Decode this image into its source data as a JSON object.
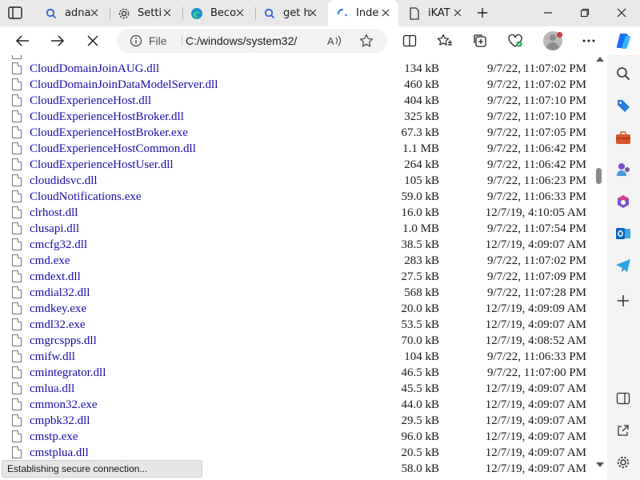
{
  "tabs": [
    {
      "title": "adna",
      "icon": "search-icon"
    },
    {
      "title": "Setti",
      "icon": "gear-icon"
    },
    {
      "title": "Beco",
      "icon": "edge-icon"
    },
    {
      "title": "get h",
      "icon": "search-icon"
    },
    {
      "title": "Inde",
      "icon": "loading-spinner-icon",
      "active": true
    },
    {
      "title": "iKAT",
      "icon": "document-icon"
    }
  ],
  "address": {
    "scheme_label": "File",
    "url": "C:/windows/system32/"
  },
  "colors": {
    "link": "#1a0dab",
    "copilot_blue": "#1b6ef3",
    "avatar_badge": "#d13438"
  },
  "files": [
    {
      "name": "CloudDomainJoinAUG.dll",
      "size": "134 kB",
      "date": "9/7/22, 11:07:02 PM"
    },
    {
      "name": "CloudDomainJoinDataModelServer.dll",
      "size": "460 kB",
      "date": "9/7/22, 11:07:02 PM"
    },
    {
      "name": "CloudExperienceHost.dll",
      "size": "404 kB",
      "date": "9/7/22, 11:07:10 PM"
    },
    {
      "name": "CloudExperienceHostBroker.dll",
      "size": "325 kB",
      "date": "9/7/22, 11:07:10 PM"
    },
    {
      "name": "CloudExperienceHostBroker.exe",
      "size": "67.3 kB",
      "date": "9/7/22, 11:07:05 PM"
    },
    {
      "name": "CloudExperienceHostCommon.dll",
      "size": "1.1 MB",
      "date": "9/7/22, 11:06:42 PM"
    },
    {
      "name": "CloudExperienceHostUser.dll",
      "size": "264 kB",
      "date": "9/7/22, 11:06:42 PM"
    },
    {
      "name": "cloudidsvc.dll",
      "size": "105 kB",
      "date": "9/7/22, 11:06:23 PM"
    },
    {
      "name": "CloudNotifications.exe",
      "size": "59.0 kB",
      "date": "9/7/22, 11:06:33 PM"
    },
    {
      "name": "clrhost.dll",
      "size": "16.0 kB",
      "date": "12/7/19, 4:10:05 AM"
    },
    {
      "name": "clusapi.dll",
      "size": "1.0 MB",
      "date": "9/7/22, 11:07:54 PM"
    },
    {
      "name": "cmcfg32.dll",
      "size": "38.5 kB",
      "date": "12/7/19, 4:09:07 AM"
    },
    {
      "name": "cmd.exe",
      "size": "283 kB",
      "date": "9/7/22, 11:07:02 PM"
    },
    {
      "name": "cmdext.dll",
      "size": "27.5 kB",
      "date": "9/7/22, 11:07:09 PM"
    },
    {
      "name": "cmdial32.dll",
      "size": "568 kB",
      "date": "9/7/22, 11:07:28 PM"
    },
    {
      "name": "cmdkey.exe",
      "size": "20.0 kB",
      "date": "12/7/19, 4:09:09 AM"
    },
    {
      "name": "cmdl32.exe",
      "size": "53.5 kB",
      "date": "12/7/19, 4:09:07 AM"
    },
    {
      "name": "cmgrcspps.dll",
      "size": "70.0 kB",
      "date": "12/7/19, 4:08:52 AM"
    },
    {
      "name": "cmifw.dll",
      "size": "104 kB",
      "date": "9/7/22, 11:06:33 PM"
    },
    {
      "name": "cmintegrator.dll",
      "size": "46.5 kB",
      "date": "9/7/22, 11:07:00 PM"
    },
    {
      "name": "cmlua.dll",
      "size": "45.5 kB",
      "date": "12/7/19, 4:09:07 AM"
    },
    {
      "name": "cmmon32.exe",
      "size": "44.0 kB",
      "date": "12/7/19, 4:09:07 AM"
    },
    {
      "name": "cmpbk32.dll",
      "size": "29.5 kB",
      "date": "12/7/19, 4:09:07 AM"
    },
    {
      "name": "cmstp.exe",
      "size": "96.0 kB",
      "date": "12/7/19, 4:09:07 AM"
    },
    {
      "name": "cmstplua.dll",
      "size": "20.5 kB",
      "date": "12/7/19, 4:09:07 AM"
    },
    {
      "name": "",
      "size": "58.0 kB",
      "date": "12/7/19, 4:09:07 AM"
    }
  ],
  "status_text": "Establishing secure connection..."
}
